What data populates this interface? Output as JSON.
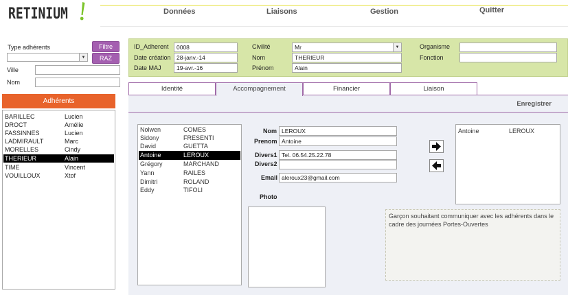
{
  "app": {
    "logo_text": "RETINIUM",
    "logo_bang": "!",
    "accent_green": "#7cc42b"
  },
  "menu": {
    "items": [
      "Données",
      "Liaisons",
      "Gestion",
      "Quitter"
    ]
  },
  "filter": {
    "type_label": "Type adhérents",
    "type_value": "",
    "filtre_button": "Filtre",
    "raz_button": "RAZ",
    "ville_label": "Ville",
    "ville_value": "",
    "nom_label": "Nom",
    "nom_value": ""
  },
  "adherents": {
    "header": "Adhérents",
    "rows": [
      {
        "nom": "BARILLEC",
        "prenom": "Lucien",
        "selected": false
      },
      {
        "nom": "DROCT",
        "prenom": "Amélie",
        "selected": false
      },
      {
        "nom": "FASSINNES",
        "prenom": "Lucien",
        "selected": false
      },
      {
        "nom": "LADMIRAULT",
        "prenom": "Marc",
        "selected": false
      },
      {
        "nom": "MORELLES",
        "prenom": "Cindy",
        "selected": false
      },
      {
        "nom": "THERIEUR",
        "prenom": "Alain",
        "selected": true
      },
      {
        "nom": "TIME",
        "prenom": "Vincent",
        "selected": false
      },
      {
        "nom": "VOUILLOUX",
        "prenom": "Xtof",
        "selected": false
      }
    ]
  },
  "record": {
    "id_label": "ID_Adherent",
    "id_value": "0008",
    "creation_label": "Date création",
    "creation_value": "28-janv.-14",
    "maj_label": "Date MAJ",
    "maj_value": "19-avr.-16",
    "civilite_label": "Civilité",
    "civilite_value": "Mr",
    "nom_label": "Nom",
    "nom_value": "THERIEUR",
    "prenom_label": "Prénom",
    "prenom_value": "Alain",
    "organisme_label": "Organisme",
    "organisme_value": "",
    "fonction_label": "Fonction",
    "fonction_value": ""
  },
  "tabs": [
    {
      "label": "Identité",
      "active": false
    },
    {
      "label": "Accompagnement",
      "active": true
    },
    {
      "label": "Financier",
      "active": false
    },
    {
      "label": "Liaison",
      "active": false
    }
  ],
  "accompagnement": {
    "save_label": "Enregistrer",
    "people": [
      {
        "prenom": "Nolwen",
        "nom": "COMES",
        "selected": false
      },
      {
        "prenom": "Sidony",
        "nom": "FRESENTI",
        "selected": false
      },
      {
        "prenom": "David",
        "nom": "GUETTA",
        "selected": false
      },
      {
        "prenom": "Antoine",
        "nom": "LEROUX",
        "selected": true
      },
      {
        "prenom": "Grégory",
        "nom": "MARCHAND",
        "selected": false
      },
      {
        "prenom": "Yann",
        "nom": "RAILES",
        "selected": false
      },
      {
        "prenom": "Dimitri",
        "nom": "ROLAND",
        "selected": false
      },
      {
        "prenom": "Eddy",
        "nom": "TIFOLI",
        "selected": false
      }
    ],
    "detail": {
      "nom_label": "Nom",
      "nom_value": "LEROUX",
      "prenom_label": "Prenom",
      "prenom_value": "Antoine",
      "divers1_label": "Divers1",
      "divers1_value": "Tel. 06.54.25.22.78",
      "divers2_label": "Divers2",
      "divers2_value": "",
      "email_label": "Email",
      "email_value": "aleroux23@gmail.com",
      "photo_label": "Photo"
    },
    "selected_people": [
      {
        "prenom": "Antoine",
        "nom": "LEROUX"
      }
    ],
    "note": "Garçon souhaitant communiquer avec les adhérents dans le cadre des journées Portes-Ouvertes"
  }
}
